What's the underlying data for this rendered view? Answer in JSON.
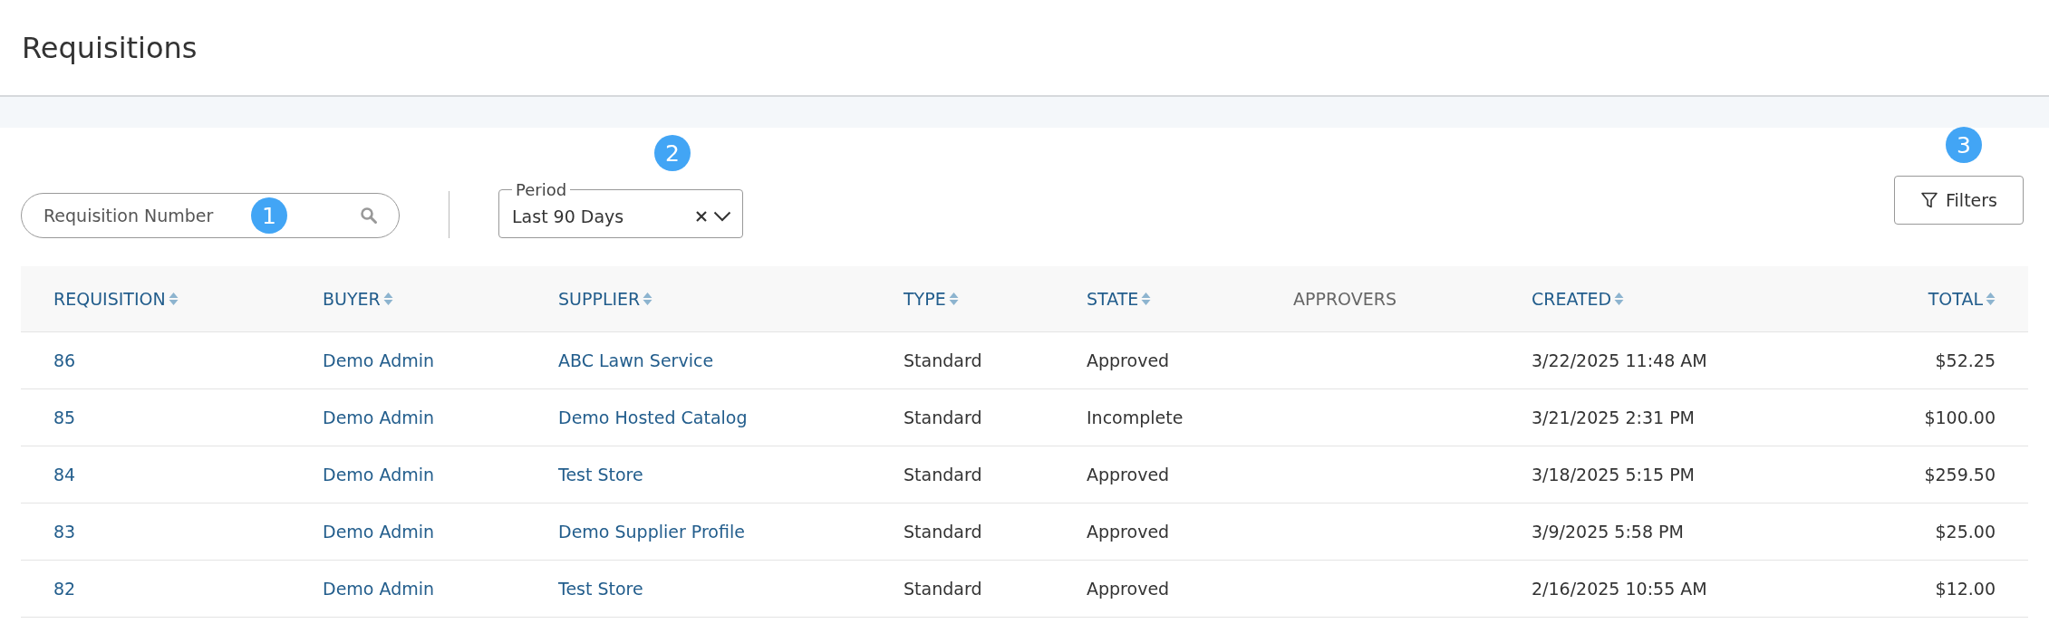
{
  "page": {
    "title": "Requisitions"
  },
  "toolbar": {
    "search": {
      "placeholder": "Requisition Number",
      "badge": "1"
    },
    "period": {
      "label": "Period",
      "value": "Last 90 Days",
      "badge": "2"
    },
    "filters": {
      "label": "Filters",
      "badge": "3"
    }
  },
  "table": {
    "columns": [
      {
        "label": "REQUISITION",
        "sortable": true,
        "kind": "link"
      },
      {
        "label": "BUYER",
        "sortable": true,
        "kind": "link"
      },
      {
        "label": "SUPPLIER",
        "sortable": true,
        "kind": "link"
      },
      {
        "label": "TYPE",
        "sortable": true,
        "kind": "text"
      },
      {
        "label": "STATE",
        "sortable": true,
        "kind": "text"
      },
      {
        "label": "APPROVERS",
        "sortable": false
      },
      {
        "label": "CREATED",
        "sortable": true,
        "kind": "text"
      },
      {
        "label": "TOTAL",
        "sortable": true,
        "kind": "text"
      }
    ],
    "rows": [
      [
        "86",
        "Demo Admin",
        "ABC Lawn Service",
        "Standard",
        "Approved",
        "",
        "3/22/2025 11:48 AM",
        "$52.25"
      ],
      [
        "85",
        "Demo Admin",
        "Demo Hosted Catalog",
        "Standard",
        "Incomplete",
        "",
        "3/21/2025 2:31 PM",
        "$100.00"
      ],
      [
        "84",
        "Demo Admin",
        "Test Store",
        "Standard",
        "Approved",
        "",
        "3/18/2025 5:15 PM",
        "$259.50"
      ],
      [
        "83",
        "Demo Admin",
        "Demo Supplier Profile",
        "Standard",
        "Approved",
        "",
        "3/9/2025 5:58 PM",
        "$25.00"
      ],
      [
        "82",
        "Demo Admin",
        "Test Store",
        "Standard",
        "Approved",
        "",
        "2/16/2025 10:55 AM",
        "$12.00"
      ]
    ]
  }
}
